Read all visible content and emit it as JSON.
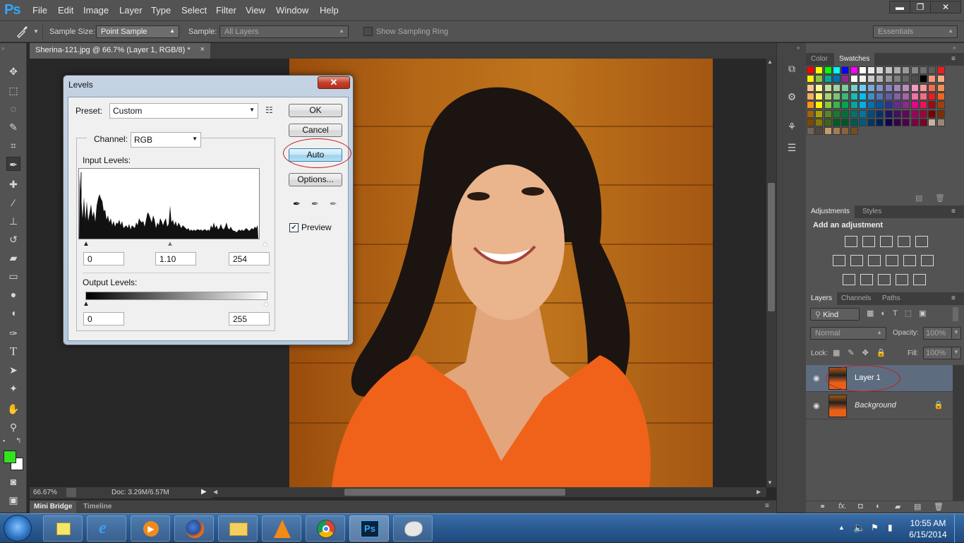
{
  "app": {
    "logo": "Ps"
  },
  "menu": [
    "File",
    "Edit",
    "Image",
    "Layer",
    "Type",
    "Select",
    "Filter",
    "View",
    "Window",
    "Help"
  ],
  "window_controls": {
    "minimize": "▬",
    "restore": "❐",
    "close": "✕"
  },
  "options_bar": {
    "sample_size_label": "Sample Size:",
    "sample_size_value": "Point Sample",
    "sample_label": "Sample:",
    "sample_value": "All Layers",
    "sampling_ring_label": "Show Sampling Ring",
    "workspace": "Essentials"
  },
  "document_tab": {
    "title": "Sherina-121.jpg @ 66.7% (Layer 1, RGB/8) *",
    "close": "×"
  },
  "status": {
    "zoom": "66.67%",
    "doc": "Doc: 3.29M/6.57M"
  },
  "bottom_tabs": [
    "Mini Bridge",
    "Timeline"
  ],
  "panels": {
    "color_tabs": [
      "Color",
      "Swatches"
    ],
    "adjustments_tabs": [
      "Adjustments",
      "Styles"
    ],
    "adjustments_heading": "Add an adjustment",
    "layers_tabs": [
      "Layers",
      "Channels",
      "Paths"
    ],
    "kind_filter": "Kind",
    "blend_mode": "Normal",
    "opacity_label": "Opacity:",
    "opacity_value": "100%",
    "lock_label": "Lock:",
    "fill_label": "Fill:",
    "fill_value": "100%",
    "layers": [
      {
        "name": "Layer 1",
        "selected": true
      },
      {
        "name": "Background",
        "locked": true
      }
    ],
    "footer_fx": "fx."
  },
  "swatch_colors": [
    "#ff0000",
    "#ffff00",
    "#00ff00",
    "#00ffff",
    "#0000ff",
    "#ff00ff",
    "#ffffff",
    "#ebebeb",
    "#d6d6d6",
    "#c2c2c2",
    "#adadad",
    "#999999",
    "#858585",
    "#707070",
    "#5c5c5c",
    "#ed1c24",
    "#fff200",
    "#8cc63f",
    "#00a99d",
    "#0072bc",
    "#92278f",
    "#ffffff",
    "#f2f2f2",
    "#cccccc",
    "#b3b3b3",
    "#999999",
    "#808080",
    "#666666",
    "#4d4d4d",
    "#000000",
    "#f7977a",
    "#f9ad81",
    "#fdc68a",
    "#fff79a",
    "#c4df9b",
    "#a2d39c",
    "#82ca9d",
    "#7bcdc8",
    "#6ecff6",
    "#7ea7d8",
    "#8493ca",
    "#8882be",
    "#a187be",
    "#bc8dbf",
    "#f49ac2",
    "#f6989d",
    "#f26c4f",
    "#f68e55",
    "#fbaf5c",
    "#fff467",
    "#acd372",
    "#7cc576",
    "#3bb878",
    "#1abbb4",
    "#00bff3",
    "#438ccb",
    "#5574b9",
    "#605ca8",
    "#855fa8",
    "#a763a8",
    "#f06ea9",
    "#f26d7d",
    "#ed1c24",
    "#f26522",
    "#f7941d",
    "#fff200",
    "#8dc73f",
    "#39b54a",
    "#00a651",
    "#00a99d",
    "#00aeef",
    "#0072bc",
    "#0054a6",
    "#2e3192",
    "#662d91",
    "#92278f",
    "#ec008c",
    "#ed145b",
    "#9e0b0f",
    "#a0410d",
    "#a36209",
    "#aba000",
    "#598527",
    "#197b30",
    "#007236",
    "#00746b",
    "#0076a3",
    "#004b80",
    "#003471",
    "#1b1464",
    "#440e62",
    "#630460",
    "#9e005d",
    "#9e0039",
    "#790000",
    "#7b2e00",
    "#7d4900",
    "#827b00",
    "#406618",
    "#005e20",
    "#005826",
    "#005952",
    "#005b7f",
    "#003663",
    "#002157",
    "#0d004c",
    "#32004b",
    "#4b0049",
    "#7b0046",
    "#7a0026",
    "#c7b299",
    "#998675",
    "#736357",
    "#534741",
    "#c69c6d",
    "#a67c52",
    "#8c6239",
    "#754c24"
  ],
  "dialog": {
    "title": "Levels",
    "close": "✕",
    "preset_label": "Preset:",
    "preset_value": "Custom",
    "channel_label": "Channel:",
    "channel_value": "RGB",
    "input_levels_label": "Input Levels:",
    "input_black": "0",
    "input_gamma": "1.10",
    "input_white": "254",
    "output_levels_label": "Output Levels:",
    "output_black": "0",
    "output_white": "255",
    "ok": "OK",
    "cancel": "Cancel",
    "auto": "Auto",
    "options": "Options...",
    "preview_label": "Preview",
    "preview_checked": true
  },
  "taskbar": {
    "time": "10:55 AM",
    "date": "6/15/2014",
    "apps": [
      "sticky-notes",
      "internet-explorer",
      "media-player",
      "firefox",
      "file-explorer",
      "vlc",
      "chrome",
      "photoshop",
      "paint"
    ]
  }
}
